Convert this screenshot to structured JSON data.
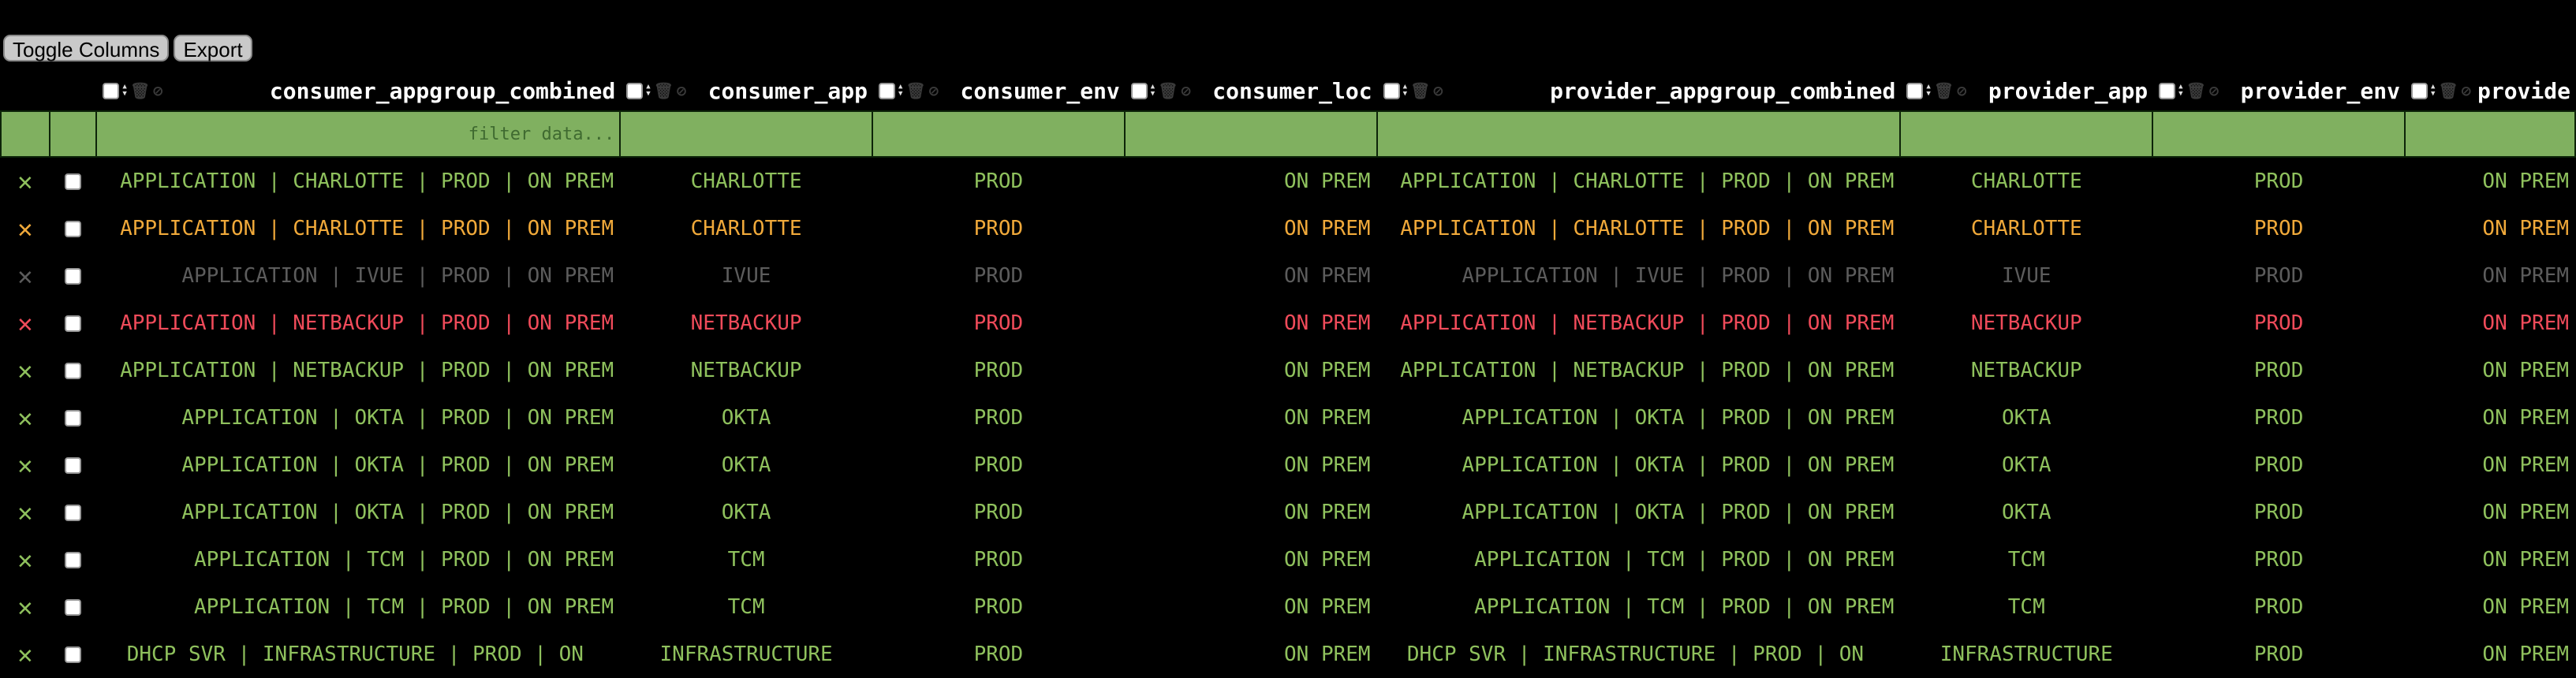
{
  "toolbar": {
    "toggle_columns": "Toggle Columns",
    "export": "Export"
  },
  "filter_placeholder": "filter data...",
  "columns": [
    "consumer_appgroup_combined",
    "consumer_app",
    "consumer_env",
    "consumer_loc",
    "provider_appgroup_combined",
    "provider_app",
    "provider_env",
    "provide"
  ],
  "colors": {
    "green": "#8fc15d",
    "orange": "#f0a93a",
    "dim": "#5c5c5c",
    "red": "#f04b5a",
    "filter_bg": "#80b060"
  },
  "rows": [
    {
      "cag": "APPLICATION | CHARLOTTE | PROD | ON PREM",
      "ca": "CHARLOTTE",
      "ce": "PROD",
      "cl": "ON PREM",
      "pag": "APPLICATION | CHARLOTTE | PROD | ON PREM",
      "pa": "CHARLOTTE",
      "pe": "PROD",
      "pl": "ON PREM"
    },
    {
      "cag": "APPLICATION | CHARLOTTE | PROD | ON PREM",
      "ca": "CHARLOTTE",
      "ce": "PROD",
      "cl": "ON PREM",
      "pag": "APPLICATION | CHARLOTTE | PROD | ON PREM",
      "pa": "CHARLOTTE",
      "pe": "PROD",
      "pl": "ON PREM"
    },
    {
      "cag": "APPLICATION | IVUE | PROD | ON PREM",
      "ca": "IVUE",
      "ce": "PROD",
      "cl": "ON PREM",
      "pag": "APPLICATION | IVUE | PROD | ON PREM",
      "pa": "IVUE",
      "pe": "PROD",
      "pl": "ON PREM"
    },
    {
      "cag": "APPLICATION | NETBACKUP | PROD | ON PREM",
      "ca": "NETBACKUP",
      "ce": "PROD",
      "cl": "ON PREM",
      "pag": "APPLICATION | NETBACKUP | PROD | ON PREM",
      "pa": "NETBACKUP",
      "pe": "PROD",
      "pl": "ON PREM"
    },
    {
      "cag": "APPLICATION | NETBACKUP | PROD | ON PREM",
      "ca": "NETBACKUP",
      "ce": "PROD",
      "cl": "ON PREM",
      "pag": "APPLICATION | NETBACKUP | PROD | ON PREM",
      "pa": "NETBACKUP",
      "pe": "PROD",
      "pl": "ON PREM"
    },
    {
      "cag": "APPLICATION | OKTA | PROD | ON PREM",
      "ca": "OKTA",
      "ce": "PROD",
      "cl": "ON PREM",
      "pag": "APPLICATION | OKTA | PROD | ON PREM",
      "pa": "OKTA",
      "pe": "PROD",
      "pl": "ON PREM"
    },
    {
      "cag": "APPLICATION | OKTA | PROD | ON PREM",
      "ca": "OKTA",
      "ce": "PROD",
      "cl": "ON PREM",
      "pag": "APPLICATION | OKTA | PROD | ON PREM",
      "pa": "OKTA",
      "pe": "PROD",
      "pl": "ON PREM"
    },
    {
      "cag": "APPLICATION | OKTA | PROD | ON PREM",
      "ca": "OKTA",
      "ce": "PROD",
      "cl": "ON PREM",
      "pag": "APPLICATION | OKTA | PROD | ON PREM",
      "pa": "OKTA",
      "pe": "PROD",
      "pl": "ON PREM"
    },
    {
      "cag": "APPLICATION | TCM | PROD | ON PREM",
      "ca": "TCM",
      "ce": "PROD",
      "cl": "ON PREM",
      "pag": "APPLICATION | TCM | PROD | ON PREM",
      "pa": "TCM",
      "pe": "PROD",
      "pl": "ON PREM"
    },
    {
      "cag": "APPLICATION | TCM | PROD | ON PREM",
      "ca": "TCM",
      "ce": "PROD",
      "cl": "ON PREM",
      "pag": "APPLICATION | TCM | PROD | ON PREM",
      "pa": "TCM",
      "pe": "PROD",
      "pl": "ON PREM"
    },
    {
      "cag": "DHCP SVR | INFRASTRUCTURE | PROD | ON",
      "ca": "INFRASTRUCTURE",
      "ce": "PROD",
      "cl": "ON PREM",
      "pag": "DHCP SVR | INFRASTRUCTURE | PROD | ON",
      "pa": "INFRASTRUCTURE",
      "pe": "PROD",
      "pl": "ON PREM"
    }
  ]
}
